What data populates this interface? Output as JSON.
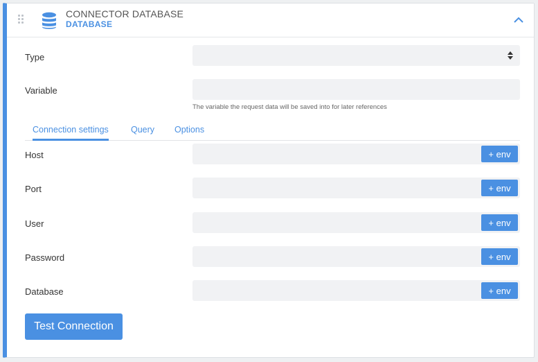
{
  "header": {
    "title": "CONNECTOR DATABASE",
    "subtitle": "DATABASE",
    "icons": {
      "drag": "drag-handle-icon",
      "database": "database-icon",
      "collapse": "chevron-up-icon"
    }
  },
  "form": {
    "type": {
      "label": "Type",
      "value": ""
    },
    "variable": {
      "label": "Variable",
      "value": "",
      "hint": "The variable the request data will be saved into for later references"
    }
  },
  "tabs": [
    {
      "label": "Connection settings",
      "active": true
    },
    {
      "label": "Query",
      "active": false
    },
    {
      "label": "Options",
      "active": false
    }
  ],
  "connection": {
    "env_label": "+ env",
    "fields": [
      {
        "label": "Host",
        "value": ""
      },
      {
        "label": "Port",
        "value": ""
      },
      {
        "label": "User",
        "value": ""
      },
      {
        "label": "Password",
        "value": ""
      },
      {
        "label": "Database",
        "value": ""
      }
    ]
  },
  "actions": {
    "test_connection": "Test Connection"
  },
  "colors": {
    "accent": "#4a90e2",
    "field_bg": "#f1f2f4",
    "border": "#dcdfe3"
  }
}
